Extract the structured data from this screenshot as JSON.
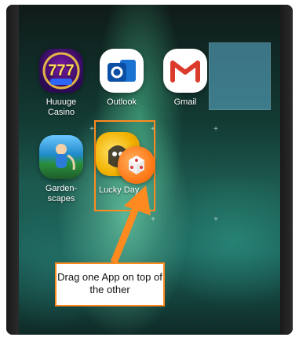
{
  "colors": {
    "accent_orange": "#ff8a1f",
    "callout_bg": "#ffffff",
    "callout_text": "#111111",
    "label_text": "#ffffff"
  },
  "icons": {
    "huuuge_casino": "slot-777-icon",
    "outlook": "outlook-o-icon",
    "gmail": "gmail-m-icon",
    "gardenscapes": "gardener-icon",
    "lucky_day": "lucky-day-dice-icon",
    "placeholder": "blank-tile"
  },
  "apps": {
    "huuuge_casino_label": "Huuuge\nCasino",
    "outlook_label": "Outlook",
    "gmail_label": "Gmail",
    "gardenscapes_label": "Garden-\nscapes",
    "lucky_day_label": "Lucky Day"
  },
  "callout": {
    "text": "Drag one App on top of the other"
  }
}
